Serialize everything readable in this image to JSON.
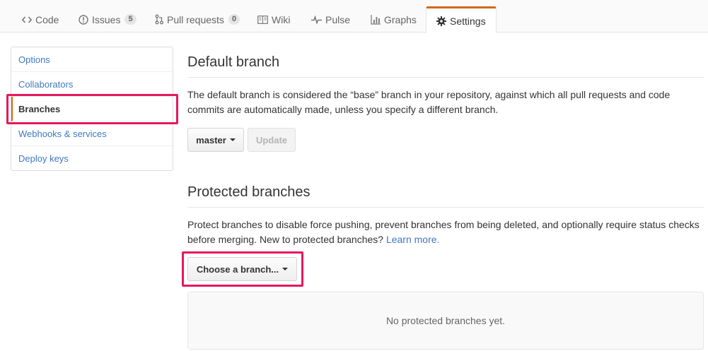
{
  "tabs": [
    {
      "label": "Code",
      "icon": "code-icon"
    },
    {
      "label": "Issues",
      "icon": "issue-opened-icon",
      "count": "5"
    },
    {
      "label": "Pull requests",
      "icon": "git-pull-request-icon",
      "count": "0"
    },
    {
      "label": "Wiki",
      "icon": "book-icon"
    },
    {
      "label": "Pulse",
      "icon": "pulse-icon"
    },
    {
      "label": "Graphs",
      "icon": "graph-icon"
    },
    {
      "label": "Settings",
      "icon": "gear-icon",
      "selected": true
    }
  ],
  "sidebar": {
    "items": [
      {
        "label": "Options"
      },
      {
        "label": "Collaborators"
      },
      {
        "label": "Branches",
        "selected": true
      },
      {
        "label": "Webhooks & services"
      },
      {
        "label": "Deploy keys"
      }
    ]
  },
  "default_branch": {
    "title": "Default branch",
    "description": "The default branch is considered the “base” branch in your repository, against which all pull requests and code commits are automatically made, unless you specify a different branch.",
    "branch_select_label": "master",
    "update_label": "Update"
  },
  "protected_branches": {
    "title": "Protected branches",
    "description": "Protect branches to disable force pushing, prevent branches from being deleted, and optionally require status checks before merging. New to protected branches?",
    "learn_more_label": "Learn more.",
    "choose_branch_label": "Choose a branch...",
    "empty_message": "No protected branches yet."
  },
  "colors": {
    "accent": "#d26911",
    "link": "#4078c0",
    "annotation_highlight": "#e5185e"
  }
}
